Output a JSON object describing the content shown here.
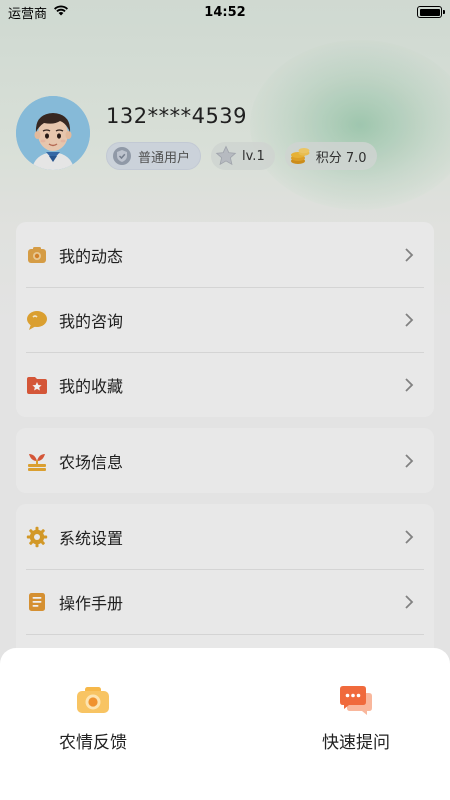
{
  "status_bar": {
    "carrier": "运营商",
    "time": "14:52"
  },
  "profile": {
    "phone": "132****4539",
    "role_label": "普通用户",
    "level_label": "lv.1",
    "points_label": "积分 7.0"
  },
  "menu_group_1": [
    {
      "label": "我的动态",
      "icon": "camera-icon"
    },
    {
      "label": "我的咨询",
      "icon": "chat-bubble-icon"
    },
    {
      "label": "我的收藏",
      "icon": "folder-star-icon"
    }
  ],
  "menu_group_2": [
    {
      "label": "农场信息",
      "icon": "farm-sprout-icon"
    }
  ],
  "menu_group_3": [
    {
      "label": "系统设置",
      "icon": "gear-icon"
    },
    {
      "label": "操作手册",
      "icon": "manual-icon"
    }
  ],
  "sheet": {
    "left_label": "农情反馈",
    "right_label": "快速提问"
  },
  "colors": {
    "accent_orange": "#f0a030",
    "accent_red": "#f06a3c"
  }
}
